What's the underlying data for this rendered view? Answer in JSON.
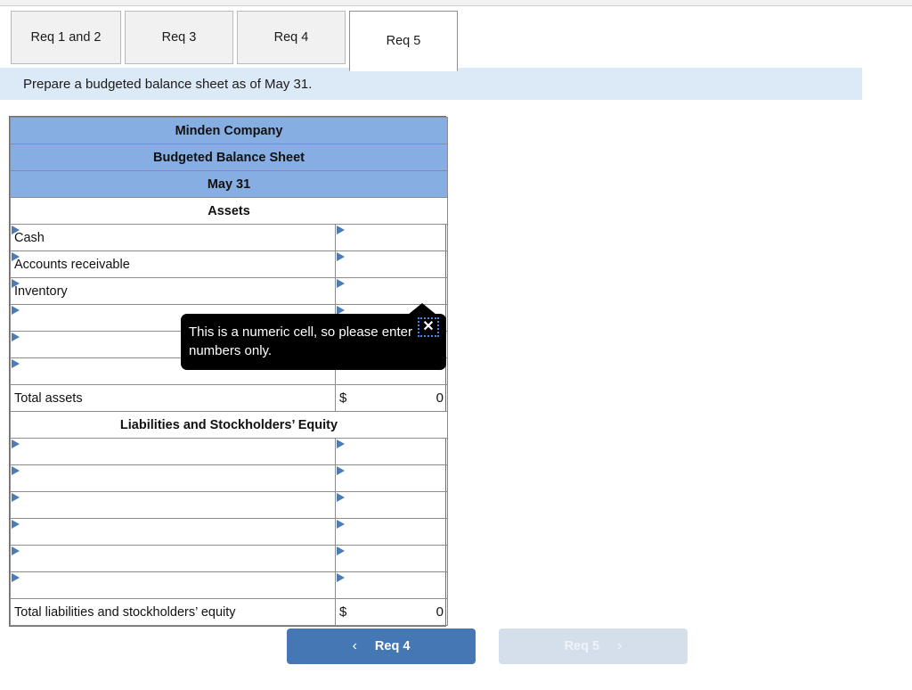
{
  "tabs": [
    {
      "label": "Req 1 and 2",
      "active": false
    },
    {
      "label": "Req 3",
      "active": false
    },
    {
      "label": "Req 4",
      "active": false
    },
    {
      "label": "Req 5",
      "active": true
    }
  ],
  "instruction": {
    "text": "Prepare a budgeted balance sheet as of May 31."
  },
  "sheet": {
    "company": "Minden Company",
    "statement": "Budgeted Balance Sheet",
    "date": "May 31",
    "assets_heading": "Assets",
    "asset_rows": [
      {
        "label": "Cash",
        "value": ""
      },
      {
        "label": "Accounts receivable",
        "value": ""
      },
      {
        "label": "Inventory",
        "value": ""
      },
      {
        "label": "",
        "value": ""
      },
      {
        "label": "",
        "value": ""
      },
      {
        "label": "",
        "value": ""
      }
    ],
    "total_assets_label": "Total assets",
    "total_assets_currency": "$",
    "total_assets_value": "0",
    "liabilities_heading": "Liabilities and Stockholders’ Equity",
    "liability_rows": [
      {
        "label": "",
        "value": ""
      },
      {
        "label": "",
        "value": ""
      },
      {
        "label": "",
        "value": ""
      },
      {
        "label": "",
        "value": ""
      },
      {
        "label": "",
        "value": ""
      },
      {
        "label": "",
        "value": ""
      }
    ],
    "total_liabilities_label": "Total liabilities and stockholders’ equity",
    "total_liabilities_currency": "$",
    "total_liabilities_value": "0"
  },
  "tooltip": {
    "message": "This is a numeric cell, so please enter numbers only.",
    "close_glyph": "✕"
  },
  "nav": {
    "prev_label": "Req 4",
    "prev_chevron": "‹",
    "next_label": "Req 5",
    "next_chevron": "›"
  },
  "colors": {
    "header_blue": "#86aee3",
    "instruction_blue": "#dceaf7",
    "button_blue": "#4577b4",
    "button_disabled": "#d5dfec",
    "marker_blue": "#4d7cb5"
  }
}
